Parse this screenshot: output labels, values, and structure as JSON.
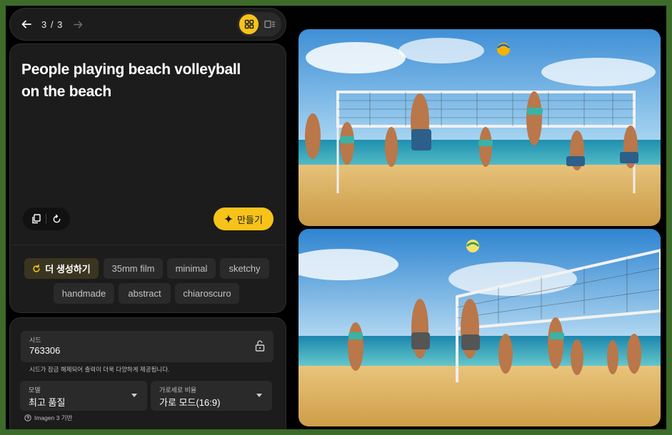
{
  "nav": {
    "counter": "3 / 3",
    "back_icon": "arrow-left-icon",
    "forward_icon": "arrow-right-icon",
    "view_grid_icon": "grid-icon",
    "view_detail_icon": "detail-view-icon"
  },
  "prompt": {
    "text": "People playing beach volleyball on the beach",
    "make_label": "만들기",
    "copy_icon": "copy-icon",
    "reset_icon": "reset-icon",
    "sparkle_icon": "sparkle-icon"
  },
  "chips": {
    "generate_more": "더 생성하기",
    "styles": [
      "35mm film",
      "minimal",
      "sketchy",
      "handmade",
      "abstract",
      "chiaroscuro"
    ]
  },
  "settings": {
    "seed_label": "시드",
    "seed_value": "763306",
    "seed_hint": "시드가 잠금 해제되어 출력이 더욱 다양하게 제공됩니다.",
    "model_label": "모델",
    "model_value": "최고 품질",
    "ratio_label": "가로세로 비율",
    "ratio_value": "가로 모드(16:9)",
    "footnote": "Imagen 3 기반"
  },
  "images": [
    {
      "name": "generated-image-1"
    },
    {
      "name": "generated-image-2"
    }
  ],
  "colors": {
    "accent": "#f7c31a",
    "frame": "#3d6b2a",
    "panel": "#1c1c1c"
  }
}
